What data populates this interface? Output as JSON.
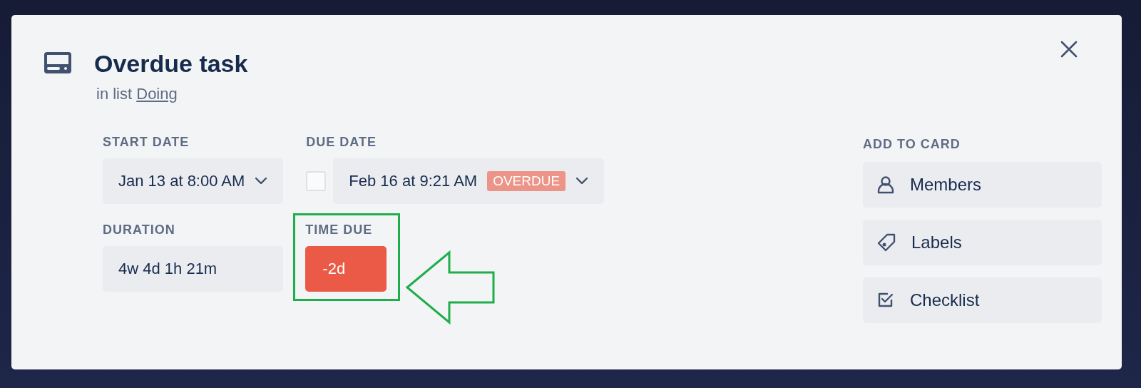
{
  "card": {
    "title": "Overdue task",
    "list_prefix": "in list",
    "list_name": "Doing"
  },
  "start_date": {
    "label": "START DATE",
    "value": "Jan 13 at 8:00 AM"
  },
  "due_date": {
    "label": "DUE DATE",
    "checked": false,
    "value": "Feb 16 at 9:21 AM",
    "badge": "OVERDUE"
  },
  "duration": {
    "label": "DURATION",
    "value": "4w 4d 1h 21m"
  },
  "time_due": {
    "label": "TIME DUE",
    "value": "-2d",
    "overdue": true
  },
  "add_to_card": {
    "title": "ADD TO CARD",
    "buttons": [
      {
        "kind": "members",
        "label": "Members"
      },
      {
        "kind": "labels",
        "label": "Labels"
      },
      {
        "kind": "checklist",
        "label": "Checklist"
      }
    ]
  }
}
